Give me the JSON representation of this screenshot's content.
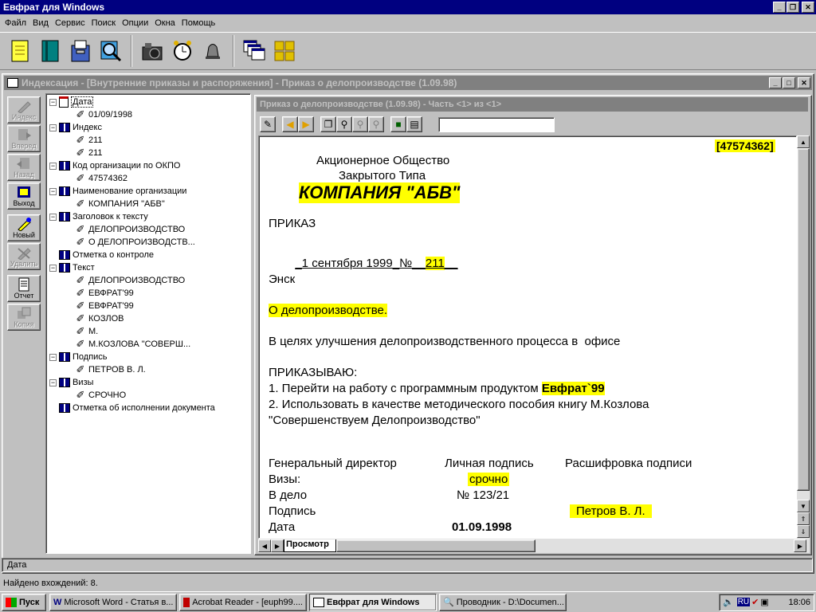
{
  "app": {
    "title": "Евфрат для Windows"
  },
  "menu": [
    "Файл",
    "Вид",
    "Сервис",
    "Поиск",
    "Опции",
    "Окна",
    "Помощь"
  ],
  "mdi": {
    "title": "Индексация - [Внутренние приказы и распоряжения] - Приказ о делопроизводстве (1.09.98)"
  },
  "side_buttons": [
    {
      "label": "Индекс",
      "icon": "pen-icon",
      "enabled": false
    },
    {
      "label": "Вперед",
      "icon": "forward-icon",
      "enabled": false
    },
    {
      "label": "Назад",
      "icon": "back-icon",
      "enabled": false
    },
    {
      "label": "Выход",
      "icon": "exit-icon",
      "enabled": true
    },
    {
      "label": "Новый",
      "icon": "new-pen-icon",
      "enabled": true
    },
    {
      "label": "Удалить",
      "icon": "delete-icon",
      "enabled": false
    },
    {
      "label": "Отчет",
      "icon": "report-icon",
      "enabled": true
    },
    {
      "label": "Копия",
      "icon": "copy-icon",
      "enabled": false
    }
  ],
  "tree": [
    {
      "level": 0,
      "label": "Дата",
      "icon": "calendar-icon",
      "expanded": true,
      "selected": true
    },
    {
      "level": 1,
      "label": "01/09/1998"
    },
    {
      "level": 0,
      "label": "Индекс",
      "expanded": true
    },
    {
      "level": 1,
      "label": "211"
    },
    {
      "level": 1,
      "label": "211"
    },
    {
      "level": 0,
      "label": "Код организации по ОКПО",
      "expanded": true
    },
    {
      "level": 1,
      "label": "47574362"
    },
    {
      "level": 0,
      "label": "Наименование организации",
      "expanded": true
    },
    {
      "level": 1,
      "label": "КОМПАНИЯ \"АБВ\""
    },
    {
      "level": 0,
      "label": "Заголовок к тексту",
      "expanded": true
    },
    {
      "level": 1,
      "label": "ДЕЛОПРОИЗВОДСТВО"
    },
    {
      "level": 1,
      "label": "О ДЕЛОПРОИЗВОДСТВ..."
    },
    {
      "level": 0,
      "label": "Отметка о контроле",
      "expanded": null
    },
    {
      "level": 0,
      "label": "Текст",
      "expanded": true
    },
    {
      "level": 1,
      "label": "ДЕЛОПРОИЗВОДСТВО"
    },
    {
      "level": 1,
      "label": "ЕВФРАТ'99"
    },
    {
      "level": 1,
      "label": "ЕВФРАТ'99"
    },
    {
      "level": 1,
      "label": "КОЗЛОВ"
    },
    {
      "level": 1,
      "label": "М."
    },
    {
      "level": 1,
      "label": "М.КОЗЛОВА \"СОВЕРШ..."
    },
    {
      "level": 0,
      "label": "Подпись",
      "expanded": true
    },
    {
      "level": 1,
      "label": "ПЕТРОВ В. Л."
    },
    {
      "level": 0,
      "label": "Визы",
      "expanded": true
    },
    {
      "level": 1,
      "label": "СРОЧНО"
    },
    {
      "level": 0,
      "label": "Отметка об исполнении документа",
      "expanded": null
    }
  ],
  "viewer": {
    "title": "Приказ о делопроизводстве (1.09.98) - Часть <1> из <1>",
    "search_value": "",
    "tab_label": "Просмотр"
  },
  "document": {
    "okpo": "47574362",
    "company_line1": "Акционерное Общество",
    "company_line2": "Закрытого Типа",
    "company_name": "КОМПАНИЯ \"АБВ\"",
    "heading": "ПРИКАЗ",
    "date_prefix": "_1 сентября 1999_№__",
    "number": "211",
    "number_suffix": "__",
    "city": "Энск",
    "subject": "О делопроизводстве.",
    "purpose": "В целях улучшения делопроизводственного процесса в  офисе",
    "order_word": "ПРИКАЗЫВАЮ:",
    "item1_text": "1. Перейти на работу с программным продуктом ",
    "item1_product": "Евфрат`99",
    "item2_line1": "2. Использовать в качестве методического пособия книгу М.Козлова",
    "item2_line2": "\"Совершенствуем Делопроизводство\"",
    "col1": "Генеральный директор",
    "col2": "Личная подпись",
    "col3": "Расшифровка подписи",
    "visa_label": "Визы:",
    "visa_value": "срочно",
    "file_label": "В дело",
    "file_value": "№ 123/21",
    "sign_label": "Подпись",
    "sign_value": "Петров В. Л.",
    "date_label": "Дата",
    "date_value": "01.09.1998"
  },
  "status": {
    "field": "Дата",
    "found": "Найдено  вхождений: 8."
  },
  "taskbar": {
    "start": "Пуск",
    "tasks": [
      {
        "label": "Microsoft Word - Статья в...",
        "icon": "word-icon",
        "active": false
      },
      {
        "label": "Acrobat Reader - [euph99....",
        "icon": "acrobat-icon",
        "active": false
      },
      {
        "label": "Евфрат для Windows",
        "icon": "euphrates-icon",
        "active": true
      },
      {
        "label": "Проводник - D:\\Documen...",
        "icon": "explorer-icon",
        "active": false
      }
    ],
    "lang": "RU",
    "time": "18:06"
  },
  "colors": {
    "titlebar": "#000080",
    "highlight": "#ffff00",
    "face": "#c0c0c0"
  }
}
